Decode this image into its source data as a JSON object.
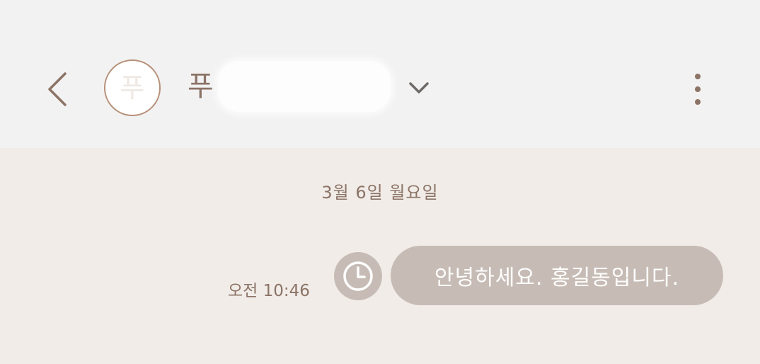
{
  "header": {
    "back_icon": "chevron-left-icon",
    "avatar_initial": "푸",
    "contact_name": "푸",
    "dropdown_icon": "chevron-down-icon",
    "more_icon": "more-vertical-icon"
  },
  "conversation": {
    "date_separator": "3월 6일 월요일",
    "messages": [
      {
        "direction": "outgoing",
        "text": "안녕하세요. 홍길동입니다.",
        "time": "오전 10:46",
        "status_icon": "clock-icon"
      }
    ]
  },
  "colors": {
    "header_background": "#f3f2f2",
    "chat_background": "#f1ece8",
    "accent_text": "#8b7366",
    "avatar_border": "#b69078",
    "bubble": "#c7bcb5",
    "bubble_text": "#ffffff"
  }
}
